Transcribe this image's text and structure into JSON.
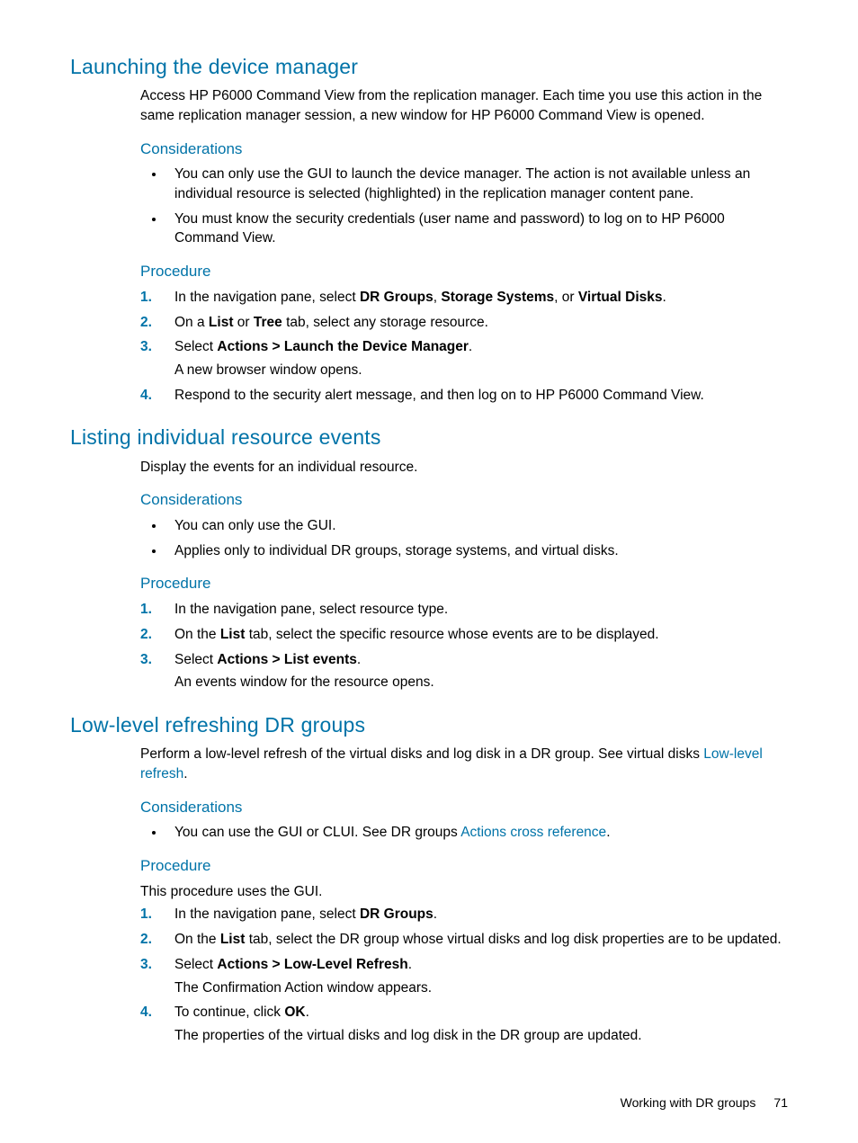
{
  "sections": [
    {
      "title": "Launching the device manager",
      "intro": "Access HP P6000 Command View from the replication manager. Each time you use this action in the same replication manager session, a new window for HP P6000 Command View is opened.",
      "considerations_label": "Considerations",
      "considerations": [
        "You can only use the GUI to launch the device manager. The action is not available unless an individual resource is selected (highlighted) in the replication manager content pane.",
        "You must know the security credentials (user name and password) to log on to HP P6000 Command View."
      ],
      "procedure_label": "Procedure",
      "steps": [
        {
          "pre": "In the navigation pane, select ",
          "bolds": [
            "DR Groups",
            "Storage Systems",
            "Virtual Disks"
          ],
          "joiners": [
            ", ",
            ", or "
          ],
          "post": "."
        },
        {
          "pre": "On a ",
          "bolds": [
            "List",
            "Tree"
          ],
          "joiners": [
            " or "
          ],
          "post": " tab, select any storage resource."
        },
        {
          "pre": "Select ",
          "bolds": [
            "Actions > Launch the Device Manager"
          ],
          "joiners": [],
          "post": ".",
          "sub": "A new browser window opens."
        },
        {
          "pre": "Respond to the security alert message, and then log on to HP P6000 Command View.",
          "bolds": [],
          "joiners": [],
          "post": ""
        }
      ]
    },
    {
      "title": "Listing individual resource events",
      "intro": "Display the events for an individual resource.",
      "considerations_label": "Considerations",
      "considerations": [
        "You can only use the GUI.",
        "Applies only to individual DR groups, storage systems, and virtual disks."
      ],
      "procedure_label": "Procedure",
      "steps": [
        {
          "pre": "In the navigation pane, select resource type.",
          "bolds": [],
          "joiners": [],
          "post": ""
        },
        {
          "pre": "On the ",
          "bolds": [
            "List"
          ],
          "joiners": [],
          "post": " tab, select the specific resource whose events are to be displayed."
        },
        {
          "pre": "Select ",
          "bolds": [
            "Actions > List events"
          ],
          "joiners": [],
          "post": ".",
          "sub": "An events window for the resource opens."
        }
      ]
    },
    {
      "title": "Low-level refreshing DR groups",
      "intro_parts": {
        "pre": "Perform a low-level refresh of the virtual disks and log disk in a DR group. See virtual disks ",
        "link": "Low-level refresh",
        "post": "."
      },
      "considerations_label": "Considerations",
      "considerations_rich": [
        {
          "pre": "You can use the GUI or CLUI. See DR groups ",
          "link": "Actions cross reference",
          "post": "."
        }
      ],
      "procedure_label": "Procedure",
      "procedure_intro": "This procedure uses the GUI.",
      "steps": [
        {
          "pre": "In the navigation pane, select ",
          "bolds": [
            "DR Groups"
          ],
          "joiners": [],
          "post": "."
        },
        {
          "pre": "On the ",
          "bolds": [
            "List"
          ],
          "joiners": [],
          "post": " tab, select the DR group whose virtual disks and log disk properties are to be updated."
        },
        {
          "pre": "Select ",
          "bolds": [
            "Actions > Low-Level Refresh"
          ],
          "joiners": [],
          "post": ".",
          "sub": "The Confirmation Action window appears."
        },
        {
          "pre": "To continue, click ",
          "bolds": [
            "OK"
          ],
          "joiners": [],
          "post": ".",
          "sub": "The properties of the virtual disks and log disk in the DR group are updated."
        }
      ]
    }
  ],
  "footer": {
    "text": "Working with DR groups",
    "page": "71"
  }
}
